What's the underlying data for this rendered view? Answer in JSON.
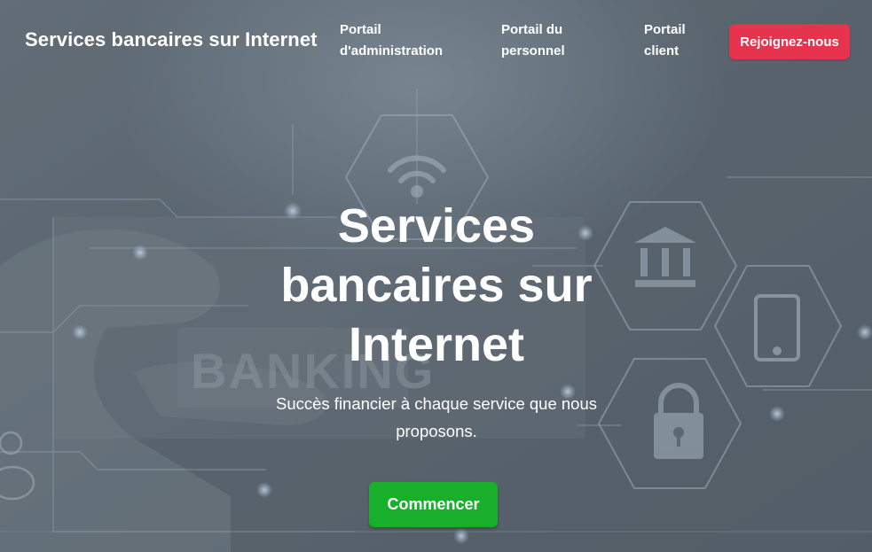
{
  "nav": {
    "brand": "Services bancaires sur Internet",
    "links": [
      "Portail d'administration",
      "Portail du personnel",
      "Portail client"
    ],
    "join_label": "Rejoignez-nous"
  },
  "hero": {
    "title": "Services bancaires sur Internet",
    "subtitle": "Succès financier à chaque service que nous proposons.",
    "cta_label": "Commencer",
    "background_text": "BANKING"
  },
  "colors": {
    "join_button": "#e6344f",
    "cta_button": "#18b02a",
    "background": "#5f6b75"
  },
  "background_icons": [
    "wifi-icon",
    "bank-icon",
    "tablet-icon",
    "padlock-icon",
    "piggy-bank-icon"
  ]
}
